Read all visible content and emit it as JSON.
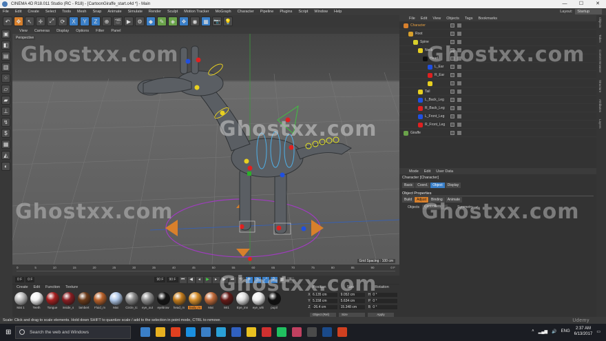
{
  "window": {
    "title": "CINEMA 4D R18.011 Studio (RC - R18) - [CartoonGiraffe_start.c4d *] - Main",
    "controls": [
      "—",
      "☐",
      "✕"
    ]
  },
  "menubar": [
    "File",
    "Edit",
    "Create",
    "Select",
    "Tools",
    "Mesh",
    "Snap",
    "Animate",
    "Simulate",
    "Render",
    "Sculpt",
    "Motion Tracker",
    "MoGraph",
    "Character",
    "Pipeline",
    "Plugins",
    "Script",
    "Window",
    "Help"
  ],
  "layout": {
    "label": "Layout:",
    "value": "Startup"
  },
  "viewport": {
    "menu": [
      "View",
      "Cameras",
      "Display",
      "Options",
      "Filter",
      "Panel"
    ],
    "camera_label": "Perspective",
    "grid_spacing": "Grid Spacing : 100 cm"
  },
  "watermark": "Ghostxx.com",
  "timeline": {
    "ticks": [
      "0",
      "5",
      "10",
      "15",
      "20",
      "25",
      "30",
      "35",
      "40",
      "45",
      "50",
      "55",
      "60",
      "65",
      "70",
      "75",
      "80",
      "85",
      "90"
    ],
    "end_label": "0 F",
    "start_field": "0 F",
    "min_field": "0 F",
    "max_field": "90 F",
    "max_field2": "90 F"
  },
  "materials": {
    "menu": [
      "Create",
      "Edit",
      "Function",
      "Texture"
    ],
    "items": [
      {
        "label": "Mat 1",
        "color": "#bcbcbc"
      },
      {
        "label": "Teeth",
        "color": "#f0f0f0"
      },
      {
        "label": "Tongue",
        "color": "#a52020"
      },
      {
        "label": "inside_s",
        "color": "#8a1e22"
      },
      {
        "label": "lambert",
        "color": "#6b3b1a"
      },
      {
        "label": "Fluid_m",
        "color": "#b8612a"
      },
      {
        "label": "Mat",
        "color": "#b0c8e8"
      },
      {
        "label": "Circle_tc",
        "color": "#8a8a8a"
      },
      {
        "label": "eye_out",
        "color": "#909090"
      },
      {
        "label": "eyebrow",
        "color": "#151515"
      },
      {
        "label": "head_m",
        "color": "#c27b1c"
      },
      {
        "label": "body_m",
        "color": "#d8902c"
      },
      {
        "label": "Mat",
        "color": "#c26b3a"
      },
      {
        "label": "Mr1",
        "color": "#651a17"
      },
      {
        "label": "Eye_inn",
        "color": "#dddddd"
      },
      {
        "label": "eye_whi",
        "color": "#eeeeee"
      },
      {
        "label": "pupil",
        "color": "#111111"
      }
    ],
    "selected_index": 11
  },
  "coords": {
    "headers": [
      "Position",
      "Size",
      "Rotation"
    ],
    "rows": [
      {
        "axis": "X",
        "pos": "6.135 cm",
        "size": "9.052 cm",
        "rot_axis": "H",
        "rot": "0 °"
      },
      {
        "axis": "Y",
        "pos": "5.158 cm",
        "size": "5.634 cm",
        "rot_axis": "P",
        "rot": "0 °"
      },
      {
        "axis": "Z",
        "pos": "-26.4 cm",
        "size": "15.348 cm",
        "rot_axis": "B",
        "rot": "0 °"
      }
    ],
    "mode": "Object (Rel)",
    "size_mode": "Size",
    "apply": "Apply"
  },
  "status": "Scale: Click and drag to scale elements. Hold down SHIFT to quantize scale / add to the selection in point mode, CTRL to remove.",
  "object_manager": {
    "menu": [
      "File",
      "Edit",
      "View",
      "Objects",
      "Tags",
      "Bookmarks"
    ],
    "rows": [
      {
        "label": "Character",
        "indent": 0,
        "color": "#d8802c",
        "highlight": true
      },
      {
        "label": "Root",
        "indent": 1,
        "color": "#d8a02c",
        "highlight": false
      },
      {
        "label": "Spine",
        "indent": 2,
        "color": "#d8d02c",
        "highlight": false
      },
      {
        "label": "Neck",
        "indent": 3,
        "color": "#e8d020",
        "highlight": false
      },
      {
        "label": "Head",
        "indent": 4,
        "color": "#101010",
        "highlight": false
      },
      {
        "label": "L_Ear",
        "indent": 5,
        "color": "#2050e0",
        "highlight": false
      },
      {
        "label": "R_Ear",
        "indent": 5,
        "color": "#e02020",
        "highlight": false
      },
      {
        "label": "",
        "indent": 5,
        "color": "#e8d020",
        "highlight": false
      },
      {
        "label": "Tail",
        "indent": 3,
        "color": "#e8d020",
        "highlight": false
      },
      {
        "label": "L_Back_Leg",
        "indent": 3,
        "color": "#2050e0",
        "highlight": false
      },
      {
        "label": "R_Back_Leg",
        "indent": 3,
        "color": "#e02020",
        "highlight": false
      },
      {
        "label": "L_Front_Leg",
        "indent": 3,
        "color": "#2050e0",
        "highlight": false
      },
      {
        "label": "R_Front_Leg",
        "indent": 3,
        "color": "#e02020",
        "highlight": false
      },
      {
        "label": "Giraffe",
        "indent": 0,
        "color": "#6aa34a",
        "highlight": false
      }
    ]
  },
  "attributes": {
    "menu": [
      "Mode",
      "Edit",
      "User Data"
    ],
    "title": "Character [Character]",
    "tabs1": [
      {
        "label": "Basic",
        "active": false
      },
      {
        "label": "Coord.",
        "active": false
      },
      {
        "label": "Object",
        "active": true
      },
      {
        "label": "Display",
        "active": false
      }
    ],
    "section": "Object Properties",
    "tabs2": [
      {
        "label": "Build",
        "active": false
      },
      {
        "label": "Adjust",
        "active": true
      },
      {
        "label": "Binding",
        "active": false
      },
      {
        "label": "Animate",
        "active": false
      }
    ],
    "objects_label": "Objects",
    "objects_value": "Controllers",
    "symmetry_label": "Symmetry",
    "symmetry_value": "✓"
  },
  "side_tabs": [
    "Objects",
    "Takes",
    "Content Browser",
    "Structure",
    "Attributes",
    "Layers"
  ],
  "taskbar": {
    "search_placeholder": "Search the web and Windows",
    "lang": "ENG",
    "time": "2:37 AM",
    "date": "6/13/2017",
    "apps": [
      "#3a7fc8",
      "#e8b020",
      "#e04020",
      "#1a8fe0",
      "#3a7fc8",
      "#2aa0d8",
      "#3060c0",
      "#e8c020",
      "#d03030",
      "#20c060",
      "#c04060",
      "#4a4a4a",
      "#1a4a8a",
      "#d04020"
    ]
  },
  "udemy": "Udemy"
}
